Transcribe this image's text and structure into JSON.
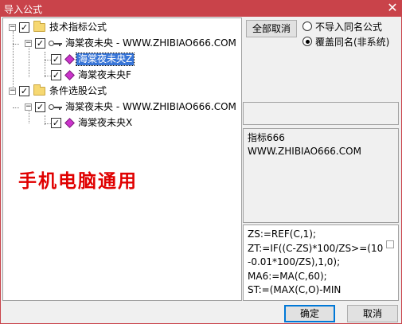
{
  "window": {
    "title": "导入公式",
    "close_glyph": "✕"
  },
  "tree": {
    "groups": [
      {
        "label": "技术指标公式",
        "checked": true,
        "expanded": true,
        "source": {
          "label": "海棠夜未央 - WWW.ZHIBIAO666.COM",
          "checked": true,
          "expanded": true,
          "items": [
            {
              "label": "海棠夜未央Z",
              "checked": true,
              "selected": true
            },
            {
              "label": "海棠夜未央F",
              "checked": true,
              "selected": false
            }
          ]
        }
      },
      {
        "label": "条件选股公式",
        "checked": true,
        "expanded": true,
        "source": {
          "label": "海棠夜未央 - WWW.ZHIBIAO666.COM",
          "checked": true,
          "expanded": true,
          "items": [
            {
              "label": "海棠夜未央X",
              "checked": true,
              "selected": false
            }
          ]
        }
      }
    ],
    "watermark": "手机电脑通用"
  },
  "options": {
    "cancel_all_label": "全部取消",
    "radio_skip_label": "不导入同名公式",
    "radio_overwrite_label": "覆盖同名(非系统)",
    "selected": "overwrite"
  },
  "description": {
    "lines": [
      "指标666",
      "WWW.ZHIBIAO666.COM"
    ]
  },
  "formula": {
    "lines": [
      "ZS:=REF(C,1);",
      "ZT:=IF((C-ZS)*100/ZS>=(10",
      "-0.01*100/ZS),1,0);",
      "MA6:=MA(C,60);",
      "ST:=(MAX(C,O)-MIN"
    ]
  },
  "footer": {
    "ok_label": "确定",
    "cancel_label": "取消"
  },
  "colors": {
    "titlebar": "#c9434a",
    "selection": "#3875d7",
    "watermark": "#e00000",
    "diamond": "#cc33cc"
  }
}
